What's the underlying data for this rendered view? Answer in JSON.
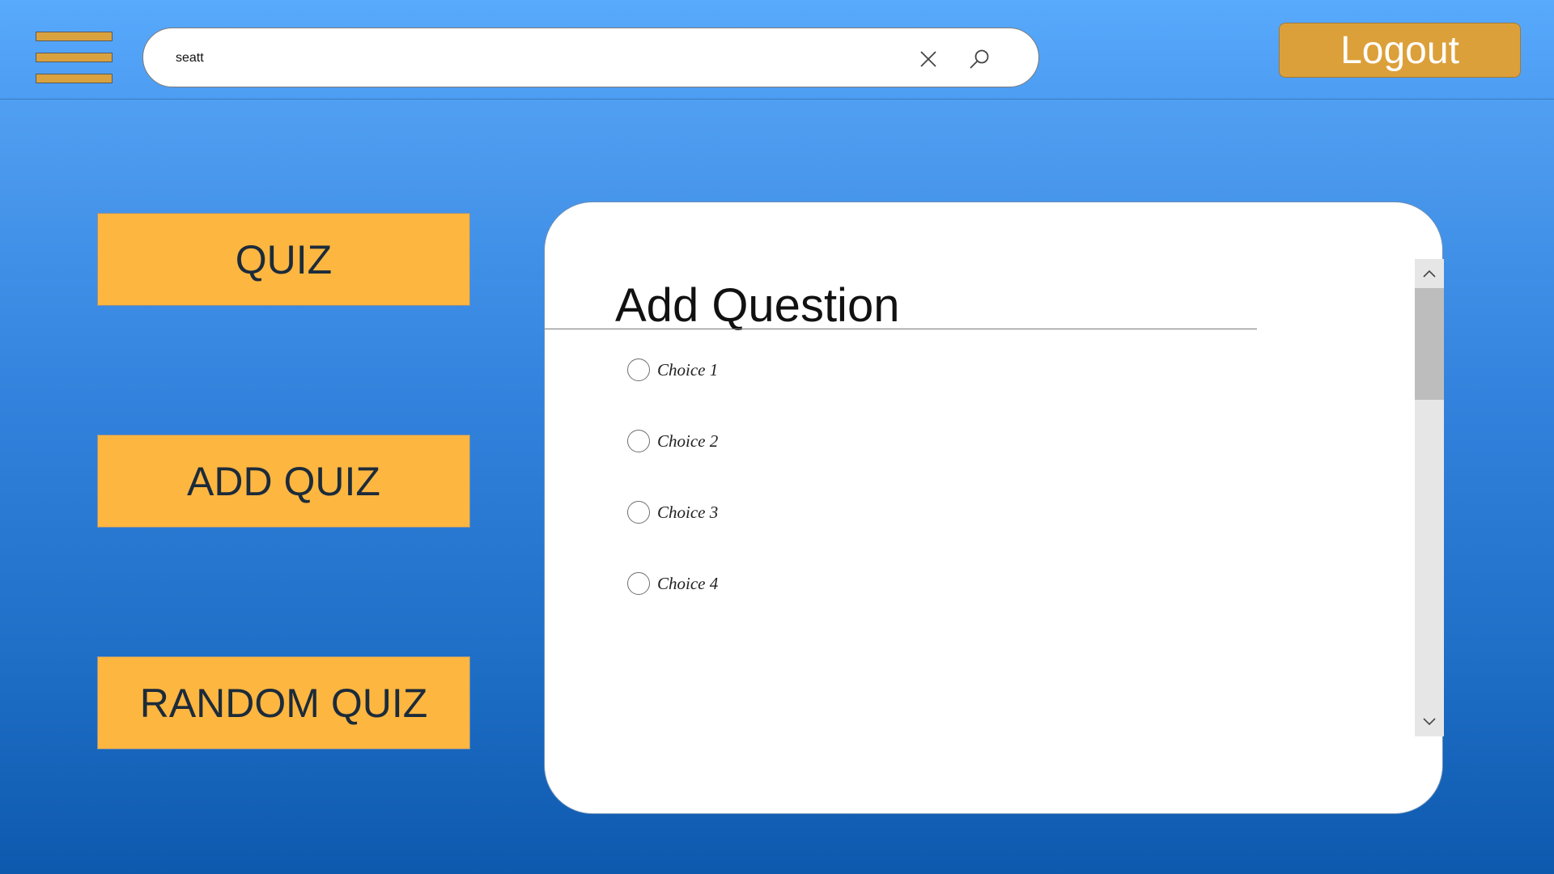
{
  "header": {
    "menu_icon": "hamburger-menu-icon",
    "search": {
      "value": "seatt",
      "placeholder": "",
      "clear_icon": "close-icon",
      "search_icon": "search-icon"
    },
    "logout_label": "Logout"
  },
  "sidebar": {
    "buttons": [
      {
        "label": "QUIZ"
      },
      {
        "label": "ADD QUIZ"
      },
      {
        "label": "RANDOM QUIZ"
      }
    ]
  },
  "panel": {
    "title": "Add Question",
    "choices": [
      {
        "label": "Choice 1"
      },
      {
        "label": "Choice 2"
      },
      {
        "label": "Choice 3"
      },
      {
        "label": "Choice 4"
      }
    ],
    "scroll_icons": {
      "up": "chevron-up-icon",
      "down": "chevron-down-icon"
    }
  },
  "colors": {
    "accent_orange": "#fdb640",
    "logout_orange": "#dca03a",
    "background_top": "#58a8fb",
    "background_bottom": "#0d59ae"
  }
}
